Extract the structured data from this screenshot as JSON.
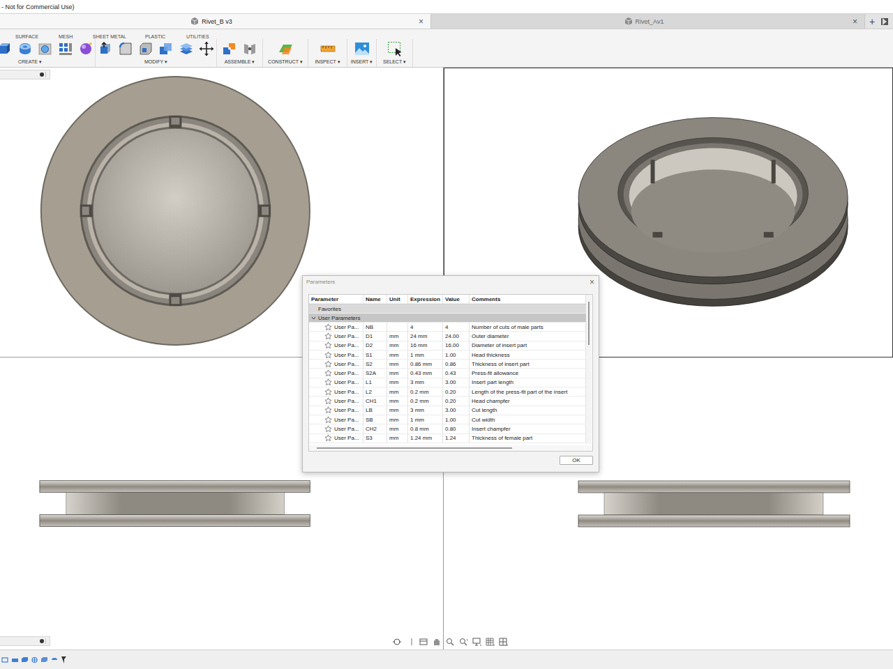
{
  "window": {
    "title": "- Not for Commercial Use)"
  },
  "tabs": [
    {
      "label": "Rivet_B v3",
      "close": "×",
      "selected": true
    },
    {
      "label": "Rivet_Av1",
      "close": "×",
      "selected": false
    }
  ],
  "new_tab": "+",
  "toolbar": {
    "tabs": [
      "SURFACE",
      "MESH",
      "SHEET METAL",
      "PLASTIC",
      "UTILITIES"
    ],
    "groups": [
      "CREATE ▾",
      "MODIFY ▾",
      "ASSEMBLE ▾",
      "CONSTRUCT ▾",
      "INSPECT ▾",
      "INSERT ▾",
      "SELECT ▾"
    ]
  },
  "dialog": {
    "title": "Parameters",
    "close": "×",
    "columns": [
      "Parameter",
      "Name",
      "Unit",
      "Expression",
      "Value",
      "Comments"
    ],
    "groups": [
      {
        "label": "Favorites"
      },
      {
        "label": "User Parameters",
        "expanded": true
      }
    ],
    "rows": [
      {
        "parameter": "User Pa...",
        "name": "NB",
        "unit": "",
        "expression": "4",
        "value": "4",
        "comment": "Number of cuts of male parts",
        "favorite": false
      },
      {
        "parameter": "User Pa...",
        "name": "D1",
        "unit": "mm",
        "expression": "24 mm",
        "value": "24.00",
        "comment": "Outer diameter",
        "favorite": false
      },
      {
        "parameter": "User Pa...",
        "name": "D2",
        "unit": "mm",
        "expression": "16 mm",
        "value": "16.00",
        "comment": "Diameter of insert part",
        "favorite": false
      },
      {
        "parameter": "User Pa...",
        "name": "S1",
        "unit": "mm",
        "expression": "1 mm",
        "value": "1.00",
        "comment": "Head thickness",
        "favorite": false
      },
      {
        "parameter": "User Pa...",
        "name": "S2",
        "unit": "mm",
        "expression": "0.86 mm",
        "value": "0.86",
        "comment": "Thickness of insert part",
        "favorite": false
      },
      {
        "parameter": "User Pa...",
        "name": "S2A",
        "unit": "mm",
        "expression": "0.43 mm",
        "value": "0.43",
        "comment": "Press-fit allowance",
        "favorite": false
      },
      {
        "parameter": "User Pa...",
        "name": "L1",
        "unit": "mm",
        "expression": "3 mm",
        "value": "3.00",
        "comment": "Insert part length",
        "favorite": false
      },
      {
        "parameter": "User Pa...",
        "name": "L2",
        "unit": "mm",
        "expression": "0.2 mm",
        "value": "0.20",
        "comment": "Length of the press-fit part of the insert",
        "favorite": false
      },
      {
        "parameter": "User Pa...",
        "name": "CH1",
        "unit": "mm",
        "expression": "0.2 mm",
        "value": "0.20",
        "comment": "Head champfer",
        "favorite": false
      },
      {
        "parameter": "User Pa...",
        "name": "LB",
        "unit": "mm",
        "expression": "3 mm",
        "value": "3.00",
        "comment": "Cut length",
        "favorite": false
      },
      {
        "parameter": "User Pa...",
        "name": "SB",
        "unit": "mm",
        "expression": "1 mm",
        "value": "1.00",
        "comment": "Cut width",
        "favorite": false
      },
      {
        "parameter": "User Pa...",
        "name": "CH2",
        "unit": "mm",
        "expression": "0.8 mm",
        "value": "0.80",
        "comment": "Insert champfer",
        "favorite": false
      },
      {
        "parameter": "User Pa...",
        "name": "S3",
        "unit": "mm",
        "expression": "1.24 mm",
        "value": "1.24",
        "comment": "Thickness of female part",
        "favorite": false
      }
    ],
    "buttons": [
      "OK"
    ]
  }
}
